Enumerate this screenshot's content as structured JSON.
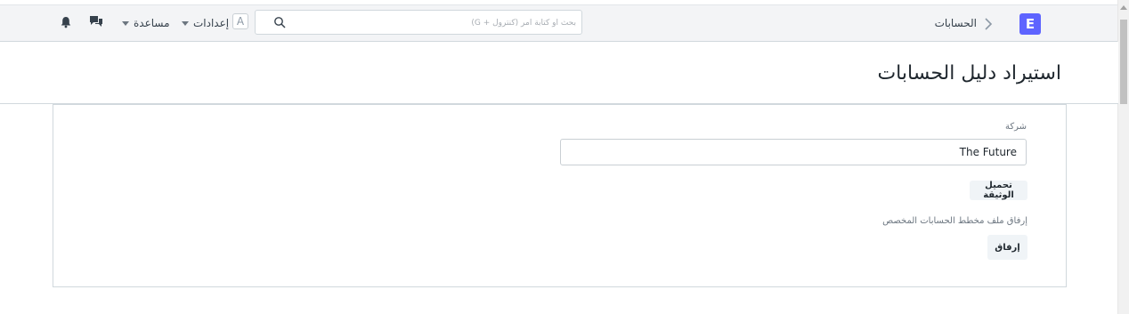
{
  "navbar": {
    "logo_letter": "E",
    "breadcrumb": "الحسابات",
    "search_placeholder": "بحث أو كتابة أمر (كنترول + G)",
    "avatar_letter": "A",
    "settings_label": "إعدادات",
    "help_label": "مساعدة"
  },
  "page": {
    "title": "استيراد دليل الحسابات"
  },
  "form": {
    "company_label": "شركة",
    "company_value": "The Future",
    "download_template_button": "تحميل الوثيقة",
    "attach_label": "إرفاق ملف مخطط الحسابات المخصص",
    "attach_button": "إرفاق"
  },
  "colors": {
    "brand": "#5e64ff",
    "navbar_bg": "#f3f4f6",
    "button_bg": "#f0f4f7"
  }
}
